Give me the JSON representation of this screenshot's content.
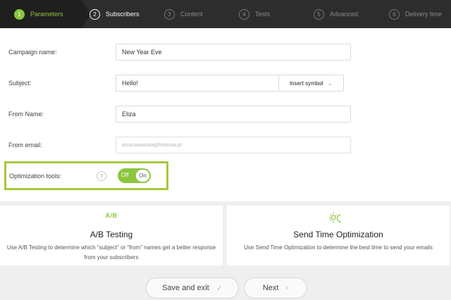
{
  "steps": [
    {
      "num": "1",
      "label": "Parameters"
    },
    {
      "num": "2",
      "label": "Subscribers"
    },
    {
      "num": "3",
      "label": "Content"
    },
    {
      "num": "4",
      "label": "Tests"
    },
    {
      "num": "5",
      "label": "Advanced"
    },
    {
      "num": "6",
      "label": "Delivery time"
    }
  ],
  "form": {
    "campaign_name_label": "Campaign name:",
    "campaign_name_value": "New Year Eve",
    "subject_label": "Subject:",
    "subject_value": "Hello!",
    "insert_symbol_label": "Insert symbol",
    "from_name_label": "From Name:",
    "from_name_value": "Eliza",
    "from_email_label": "From email:",
    "from_email_value": "eliza.kowalska@fredmail.pl",
    "optimization_label": "Optimization tools:",
    "help_glyph": "?",
    "toggle_off_label": "Off",
    "toggle_on_label": "On",
    "toggle_state": "on"
  },
  "features": {
    "ab": {
      "icon_text": "A/B",
      "title": "A/B Testing",
      "description": "Use A/B Testing to determine which \"subject\" or \"from\" names get a better response from your subscribers"
    },
    "sto": {
      "icon": "sun-moon-icon",
      "title": "Send Time Optimization",
      "description": "Use Send Time Optimization to determine the best time to send your emails"
    }
  },
  "buttons": {
    "save_exit_label": "Save and exit",
    "save_exit_glyph": "✓",
    "next_label": "Next",
    "next_glyph": "›"
  },
  "colors": {
    "accent": "#8cc63f",
    "highlight_border": "#a6c93b",
    "steps_bg": "#2d2d2d"
  }
}
